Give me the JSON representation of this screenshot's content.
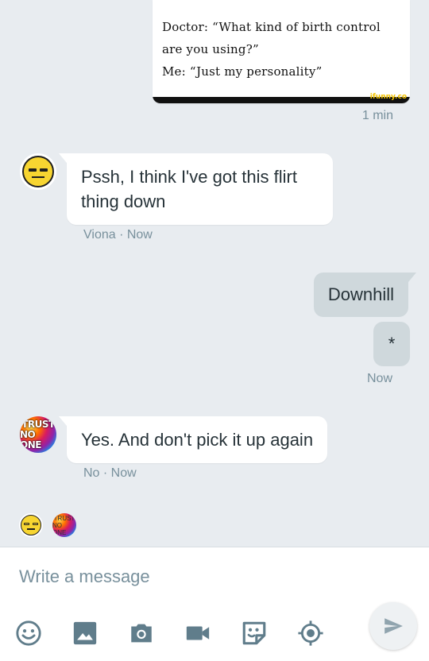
{
  "messages": {
    "image_message": {
      "text_line1": "Doctor: “What kind of birth control",
      "text_line2": "are you using?”",
      "text_line3": "Me: “Just my personality”",
      "watermark": "ifunny.co",
      "time": "1 min"
    },
    "incoming_1": {
      "text": "Pssh, I think I've got this flirt thing down",
      "meta": "Viona · Now"
    },
    "outgoing_1": {
      "text": "Downhill"
    },
    "outgoing_2": {
      "text": "*",
      "time": "Now"
    },
    "incoming_2": {
      "text": "Yes. And don't pick it up again",
      "meta": "No · Now",
      "avatar_text_1": "TRUST",
      "avatar_text_2": "NO ONE"
    }
  },
  "read_receipts": {
    "trust_text_1": "TRUST",
    "trust_text_2": "NO ONE"
  },
  "composer": {
    "placeholder": "Write a message",
    "tools": [
      "emoji-icon",
      "image-icon",
      "camera-icon",
      "video-icon",
      "sticker-icon",
      "location-icon"
    ],
    "send_icon": "send-icon"
  },
  "colors": {
    "background": "#e8ecf0",
    "incoming_bubble": "#ffffff",
    "outgoing_bubble": "#cfd8dc",
    "icon": "#607d8b",
    "meta_text": "#78909c"
  }
}
